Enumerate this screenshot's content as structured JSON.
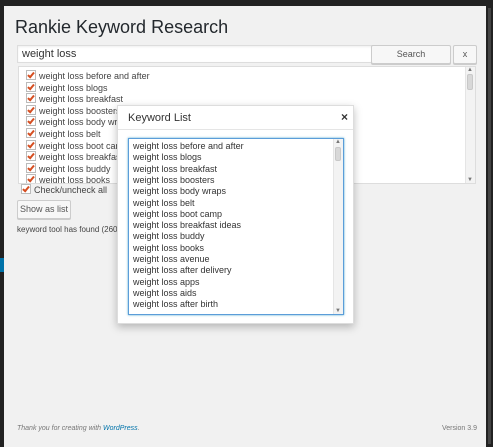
{
  "app": {
    "title": "Rankie Keyword Research"
  },
  "search": {
    "value": "weight loss",
    "search_label": "Search",
    "clear_label": "x"
  },
  "keywords": [
    "weight loss before and after",
    "weight loss blogs",
    "weight loss breakfast",
    "weight loss boosters",
    "weight loss body wraps",
    "weight loss belt",
    "weight loss boot camp",
    "weight loss breakfast ideas",
    "weight loss buddy",
    "weight loss books"
  ],
  "check_all_label": "Check/uncheck all",
  "show_list_label": "Show as list",
  "found_text": "keyword tool has found (260",
  "modal": {
    "title": "Keyword List",
    "close_label": "×",
    "lines": [
      "weight loss before and after",
      "weight loss blogs",
      "weight loss breakfast",
      "weight loss boosters",
      "weight loss body wraps",
      "weight loss belt",
      "weight loss boot camp",
      "weight loss breakfast ideas",
      "weight loss buddy",
      "weight loss books",
      "weight loss avenue",
      "weight loss after delivery",
      "weight loss apps",
      "weight loss aids",
      "weight loss after birth"
    ]
  },
  "footer": {
    "thanks_prefix": "Thank you for creating with ",
    "wordpress_link": "WordPress",
    "thanks_suffix": ".",
    "version": "Version 3.9"
  },
  "colors": {
    "accent": "#0073aa",
    "check": "#d54e21",
    "focus": "#5b9dd9"
  }
}
